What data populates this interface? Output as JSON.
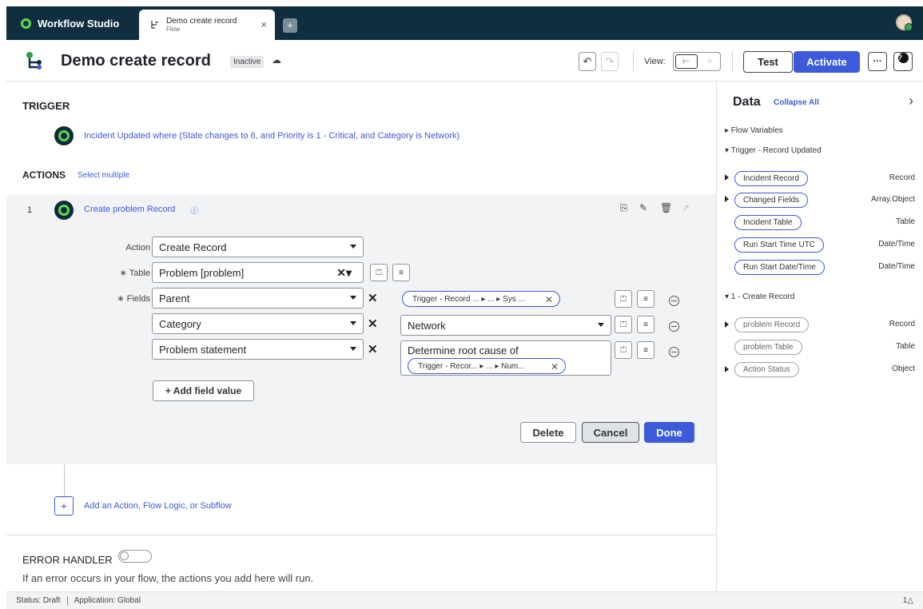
{
  "app": {
    "name": "Workflow Studio"
  },
  "tab": {
    "title": "Demo create record",
    "subtitle": "Flow",
    "close": "×",
    "add": "+"
  },
  "flow": {
    "title": "Demo create record",
    "status_badge": "Inactive"
  },
  "toolbar": {
    "undo": "↶",
    "redo": "↷",
    "view_label": "View:",
    "test": "Test",
    "activate": "Activate",
    "more": "···",
    "help": "?"
  },
  "trigger": {
    "heading": "TRIGGER",
    "condition": "Incident Updated where (State changes to 6, and Priority is 1 - Critical, and Category is Network)"
  },
  "actions": {
    "heading": "ACTIONS",
    "select_multiple": "Select multiple"
  },
  "action1": {
    "number": "1",
    "title": "Create problem Record",
    "action_label": "Action",
    "action_value": "Create Record",
    "table_label": "∗ Table",
    "table_value": "Problem [problem]",
    "fields_label": "∗ Fields",
    "fields": [
      {
        "name": "Parent",
        "pill": "Trigger - Record ...  ▸ ...  ▸ Sys ..."
      },
      {
        "name": "Category",
        "value": "Network"
      },
      {
        "name": "Problem statement",
        "value": "Determine root cause of",
        "pill": "Trigger - Recor...  ▸ ...  ▸ Num..."
      }
    ],
    "add_field": "+ Add field value",
    "delete": "Delete",
    "cancel": "Cancel",
    "done": "Done"
  },
  "add_action": {
    "plus": "+",
    "label": "Add an Action, Flow Logic, or Subflow"
  },
  "error_handler": {
    "heading": "ERROR HANDLER",
    "description": "If an error occurs in your flow, the actions you add here will run."
  },
  "data_panel": {
    "title": "Data",
    "collapse_all": "Collapse All",
    "chevron": "›",
    "flow_variables": "▸ Flow Variables",
    "trigger_section": "▾ Trigger - Record Updated",
    "trigger_items": [
      {
        "name": "Incident Record",
        "type": "Record"
      },
      {
        "name": "Changed Fields",
        "type": "Array.Object"
      },
      {
        "name": "Incident Table",
        "type": "Table"
      },
      {
        "name": "Run Start Time UTC",
        "type": "Date/Time"
      },
      {
        "name": "Run Start Date/Time",
        "type": "Date/Time"
      }
    ],
    "action_section": "▾ 1 - Create Record",
    "action_items": [
      {
        "name": "problem Record",
        "type": "Record"
      },
      {
        "name": "problem Table",
        "type": "Table"
      },
      {
        "name": "Action Status",
        "type": "Object"
      }
    ]
  },
  "status": {
    "state": "Status: Draft",
    "application": "Application: Global",
    "notifications": "1△"
  }
}
